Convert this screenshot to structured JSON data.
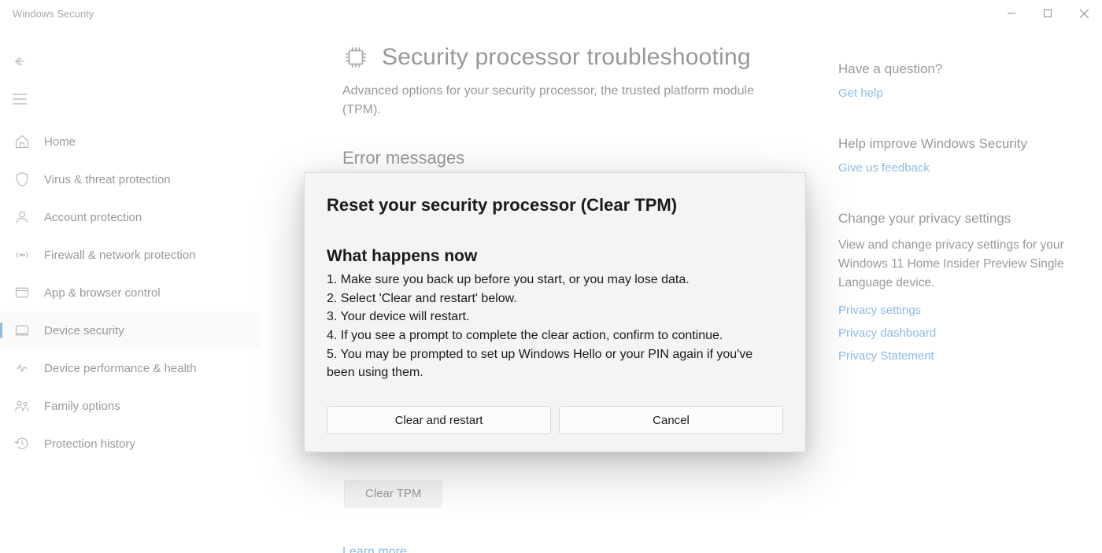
{
  "window": {
    "title": "Windows Security"
  },
  "nav": {
    "items": [
      {
        "icon": "home",
        "label": "Home"
      },
      {
        "icon": "shield",
        "label": "Virus & threat protection"
      },
      {
        "icon": "user",
        "label": "Account protection"
      },
      {
        "icon": "wifi",
        "label": "Firewall & network protection"
      },
      {
        "icon": "app",
        "label": "App & browser control"
      },
      {
        "icon": "device",
        "label": "Device security",
        "selected": true
      },
      {
        "icon": "heart",
        "label": "Device performance & health"
      },
      {
        "icon": "family",
        "label": "Family options"
      },
      {
        "icon": "history",
        "label": "Protection history"
      }
    ]
  },
  "page": {
    "title": "Security processor troubleshooting",
    "subtitle": "Advanced options for your security processor, the trusted platform module (TPM).",
    "error_heading": "Error messages",
    "clear_tpm_label": "Clear TPM",
    "learn_more_label": "Learn more"
  },
  "right": {
    "question_heading": "Have a question?",
    "get_help": "Get help",
    "improve_heading": "Help improve Windows Security",
    "feedback": "Give us feedback",
    "privacy_heading": "Change your privacy settings",
    "privacy_body": "View and change privacy settings for your Windows 11 Home Insider Preview Single Language device.",
    "privacy_settings": "Privacy settings",
    "privacy_dashboard": "Privacy dashboard",
    "privacy_statement": "Privacy Statement"
  },
  "dialog": {
    "title": "Reset your security processor (Clear TPM)",
    "subtitle": "What happens now",
    "step1": "1. Make sure you back up before you start, or you may lose data.",
    "step2": "2. Select 'Clear and restart' below.",
    "step3": "3. Your device will restart.",
    "step4": "4. If you see a prompt to complete the clear action, confirm to continue.",
    "step5": "5. You may be prompted to set up Windows Hello or your PIN again if you've been using them.",
    "primary": "Clear and restart",
    "secondary": "Cancel"
  }
}
